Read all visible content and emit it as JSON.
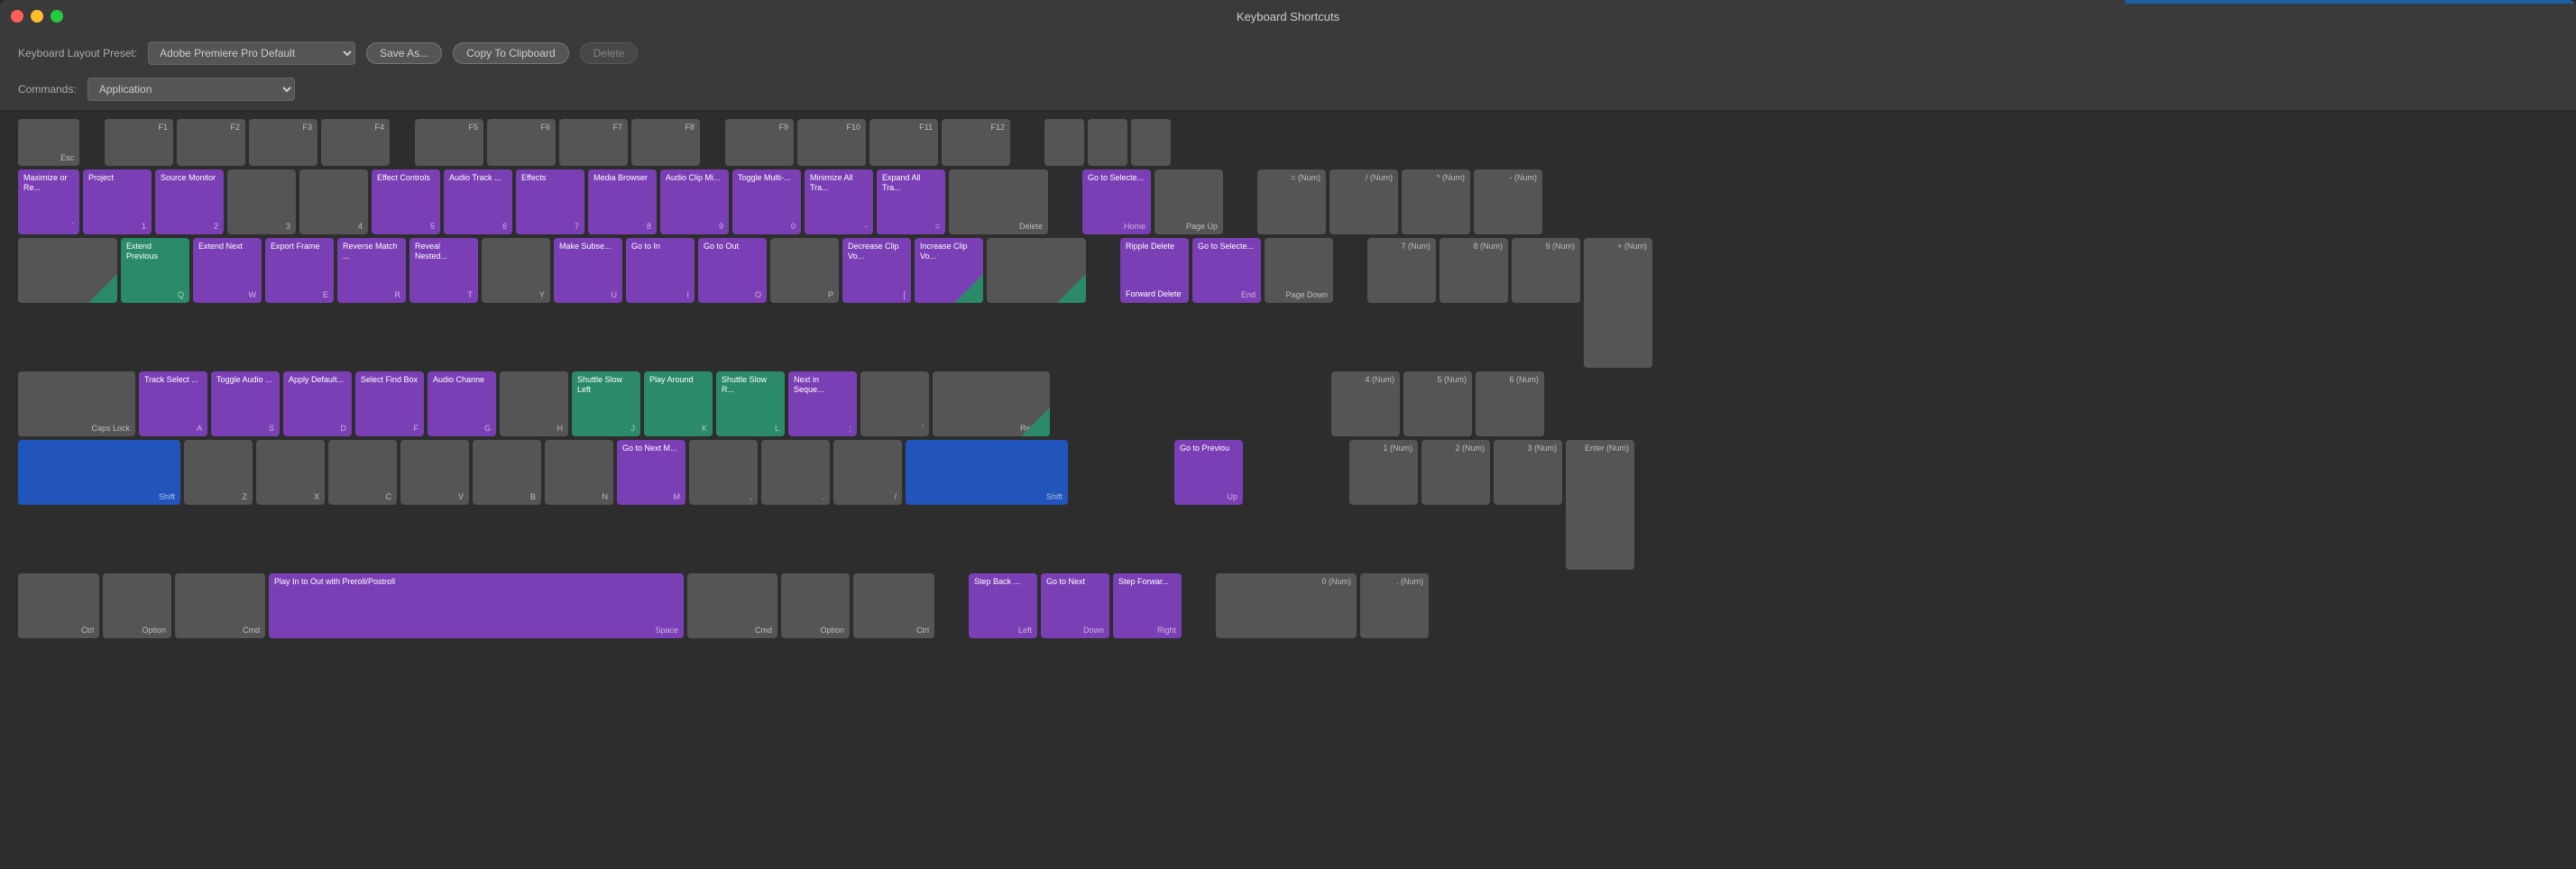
{
  "window": {
    "title": "Keyboard Shortcuts"
  },
  "toolbar": {
    "preset_label": "Keyboard Layout Preset:",
    "preset_value": "Adobe Premiere Pro Default",
    "save_as": "Save As...",
    "copy_clipboard": "Copy To Clipboard",
    "delete": "Delete",
    "commands_label": "Commands:",
    "commands_value": "Application"
  },
  "keys": {
    "f_row": [
      "F1",
      "F2",
      "F3",
      "F4",
      "F5",
      "F6",
      "F7",
      "F8",
      "F9",
      "F10",
      "F11",
      "F12"
    ],
    "num_row": {
      "labels": [
        "Maximize or Re...",
        "Project",
        "Source Monitor",
        "",
        "",
        "Effect Controls",
        "Audio Track ...",
        "Effects",
        "Media Browser",
        "Audio Clip Mi...",
        "Toggle Multi-...",
        "Minimize All Tra...",
        "Expand All Tra...",
        "",
        "",
        "",
        "",
        "",
        "",
        "",
        ""
      ],
      "chars": [
        "`",
        "1",
        "2",
        "3",
        "4",
        "5",
        "6",
        "7",
        "8",
        "9",
        "0",
        "-",
        "=",
        "Delete"
      ]
    }
  }
}
